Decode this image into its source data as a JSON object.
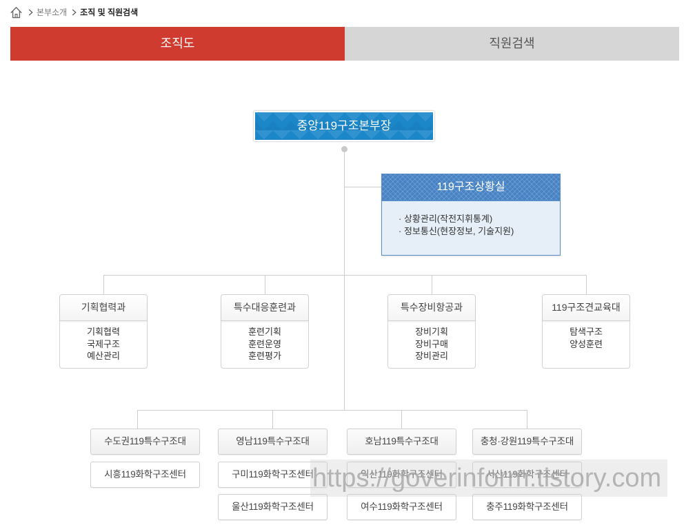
{
  "breadcrumb": {
    "home_icon": "home-icon",
    "separator_icon": "chevron-right-icon",
    "items": [
      "본부소개",
      "조직 및 직원검색"
    ]
  },
  "tabs": [
    {
      "label": "조직도",
      "active": true
    },
    {
      "label": "직원검색",
      "active": false
    }
  ],
  "org": {
    "head": "중앙119구조본부장",
    "situation_room": {
      "title": "119구조상황실",
      "items": [
        "· 상황관리(작전지휘통계)",
        "· 정보통신(현장정보, 기술지원)"
      ]
    },
    "departments": [
      {
        "name": "기획협력과",
        "items": [
          "기획협력",
          "국제구조",
          "예산관리"
        ]
      },
      {
        "name": "특수대응훈련과",
        "items": [
          "훈련기획",
          "훈련운영",
          "훈련평가"
        ]
      },
      {
        "name": "특수장비항공과",
        "items": [
          "장비기획",
          "장비구매",
          "장비관리"
        ]
      },
      {
        "name": "119구조견교육대",
        "items": [
          "탐색구조",
          "양성훈련"
        ]
      }
    ],
    "regional_units": [
      {
        "name": "수도권119특수구조대",
        "centers": [
          "시흥119화학구조센터"
        ]
      },
      {
        "name": "영남119특수구조대",
        "centers": [
          "구미119화학구조센터",
          "울산119화학구조센터"
        ]
      },
      {
        "name": "호남119특수구조대",
        "centers": [
          "익산119화학구조센터",
          "여수119화학구조센터"
        ]
      },
      {
        "name": "충청·강원119특수구조대",
        "centers": [
          "서산119화학구조센터",
          "충주119화학구조센터"
        ]
      }
    ]
  },
  "watermark": "https://goverinform.tistory.com",
  "colors": {
    "tab_active_bg": "#cf3b2e",
    "tab_inactive_bg": "#d6d6d6",
    "tab_inactive_text": "#555555",
    "head_box_bg": "#1b87c9",
    "situation_header_bg": "#4682c4",
    "situation_body_bg": "#e6eff8",
    "connector_line": "#cccccc"
  }
}
